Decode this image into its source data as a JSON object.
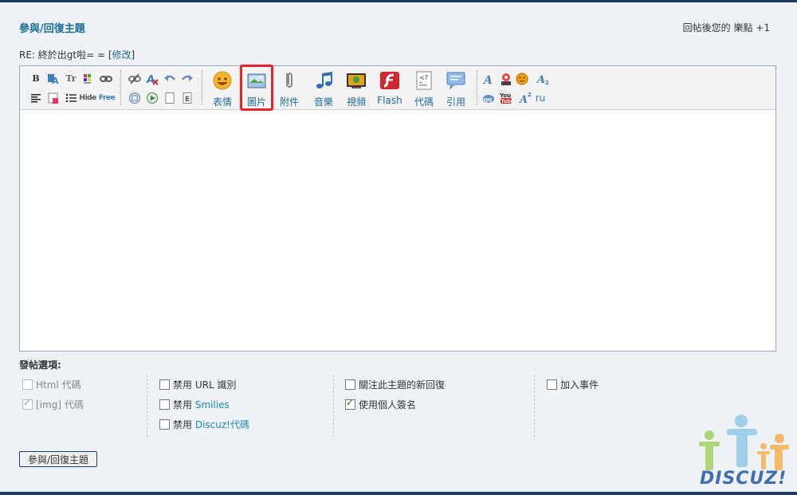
{
  "header": {
    "title": "參與/回復主題",
    "credit_note": "回帖後您的 樂點 +1"
  },
  "subject": {
    "text": "RE: 終於出gt啦= = ",
    "edit_link": "修改",
    "bracket_open": "[",
    "bracket_close": "]"
  },
  "toolbar": {
    "small_row1": [
      "B",
      "font-icon",
      "Tr",
      "color-icon",
      "link-icon",
      "unlink-icon",
      "removeformat-icon",
      "undo-icon",
      "redo-icon"
    ],
    "small_row2": [
      "align-icon",
      "table-icon",
      "list-icon",
      "Hide",
      "Free",
      "float-icon",
      "media-icon",
      "page-icon",
      "index-icon"
    ],
    "hide_label": "Hide",
    "free_label": "Free",
    "tools": [
      {
        "label": "表情",
        "icon": "smiley-icon"
      },
      {
        "label": "圖片",
        "icon": "image-icon"
      },
      {
        "label": "附件",
        "icon": "paperclip-icon"
      },
      {
        "label": "音樂",
        "icon": "music-icon"
      },
      {
        "label": "視頻",
        "icon": "video-icon"
      },
      {
        "label": "Flash",
        "icon": "flash-icon"
      },
      {
        "label": "代碼",
        "icon": "code-icon"
      },
      {
        "label": "引用",
        "icon": "quote-icon"
      }
    ],
    "ru_label": "ru",
    "highlight_color": "#e8232c"
  },
  "options": {
    "title": "發帖選項:",
    "col1": [
      {
        "label": "Html 代碼",
        "checked": false,
        "disabled": true
      },
      {
        "label": "[img] 代碼",
        "checked": true,
        "disabled": true
      }
    ],
    "col2": [
      {
        "prefix": "禁用",
        "label": "URL 識別",
        "checked": false
      },
      {
        "prefix": "禁用",
        "label": "Smilies",
        "checked": false
      },
      {
        "prefix": "禁用",
        "label": "Discuz!代碼",
        "checked": false
      }
    ],
    "col3": [
      {
        "label": "關注此主題的新回復",
        "checked": false
      },
      {
        "label": "使用個人簽名",
        "checked": true
      }
    ],
    "col4": [
      {
        "label": "加入事件",
        "checked": false
      }
    ]
  },
  "submit_label": "參與/回復主題",
  "logo_text": "DISCUZ!"
}
